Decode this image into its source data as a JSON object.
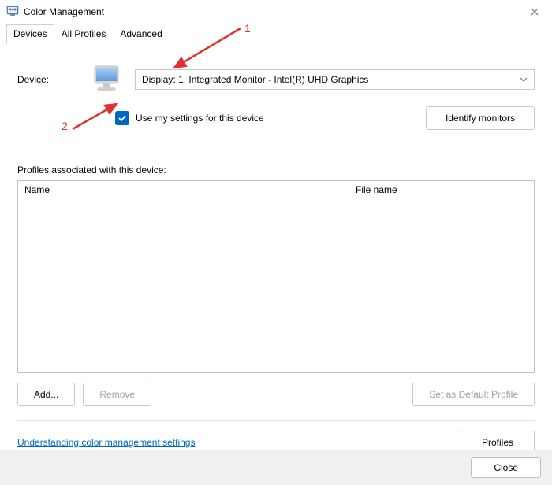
{
  "window": {
    "title": "Color Management"
  },
  "tabs": {
    "devices": "Devices",
    "all_profiles": "All Profiles",
    "advanced": "Advanced"
  },
  "device": {
    "label": "Device:",
    "selected": "Display: 1. Integrated Monitor - Intel(R) UHD Graphics"
  },
  "checkbox": {
    "label": "Use my settings for this device",
    "checked": true
  },
  "buttons": {
    "identify": "Identify monitors",
    "add": "Add...",
    "remove": "Remove",
    "set_default": "Set as Default Profile",
    "profiles": "Profiles",
    "close": "Close"
  },
  "profiles": {
    "section_label": "Profiles associated with this device:",
    "col_name": "Name",
    "col_filename": "File name"
  },
  "link": {
    "text": "Understanding color management settings"
  },
  "annotations": {
    "one": "1",
    "two": "2"
  }
}
